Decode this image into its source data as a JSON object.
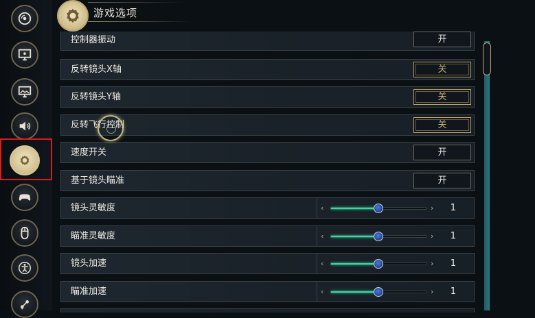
{
  "header": {
    "title": "游戏选项",
    "emblem_icon": "gear-icon"
  },
  "sidebar": {
    "items": [
      {
        "icon": "disc-icon",
        "active": false
      },
      {
        "icon": "monitor-icon",
        "active": false
      },
      {
        "icon": "image-display-icon",
        "active": false
      },
      {
        "icon": "speaker-icon",
        "active": false
      },
      {
        "icon": "gear-icon",
        "active": true
      },
      {
        "icon": "gamepad-icon",
        "active": false
      },
      {
        "icon": "mouse-icon",
        "active": false
      },
      {
        "icon": "accessibility-icon",
        "active": false
      },
      {
        "icon": "network-icon",
        "active": false
      }
    ]
  },
  "settings": {
    "rows": [
      {
        "label": "控制器振动",
        "type": "toggle",
        "value": "开"
      },
      {
        "label": "反转镜头X轴",
        "type": "toggle",
        "value": "关"
      },
      {
        "label": "反转镜头Y轴",
        "type": "toggle",
        "value": "关"
      },
      {
        "label": "反转飞行控制",
        "type": "toggle",
        "value": "关"
      },
      {
        "label": "速度开关",
        "type": "toggle",
        "value": "开"
      },
      {
        "label": "基于镜头瞄准",
        "type": "toggle",
        "value": "开"
      },
      {
        "label": "镜头灵敏度",
        "type": "slider",
        "value": "1",
        "fraction": 0.5
      },
      {
        "label": "瞄准灵敏度",
        "type": "slider",
        "value": "1",
        "fraction": 0.5
      },
      {
        "label": "镜头加速",
        "type": "slider",
        "value": "1",
        "fraction": 0.5
      },
      {
        "label": "瞄准加速",
        "type": "slider",
        "value": "1",
        "fraction": 0.5
      }
    ]
  },
  "colors": {
    "accent_gold": "#c7b07a",
    "slider_fill": "#39d6a0",
    "scrollbar": "#2c7683",
    "highlight_frame": "#e01818"
  }
}
